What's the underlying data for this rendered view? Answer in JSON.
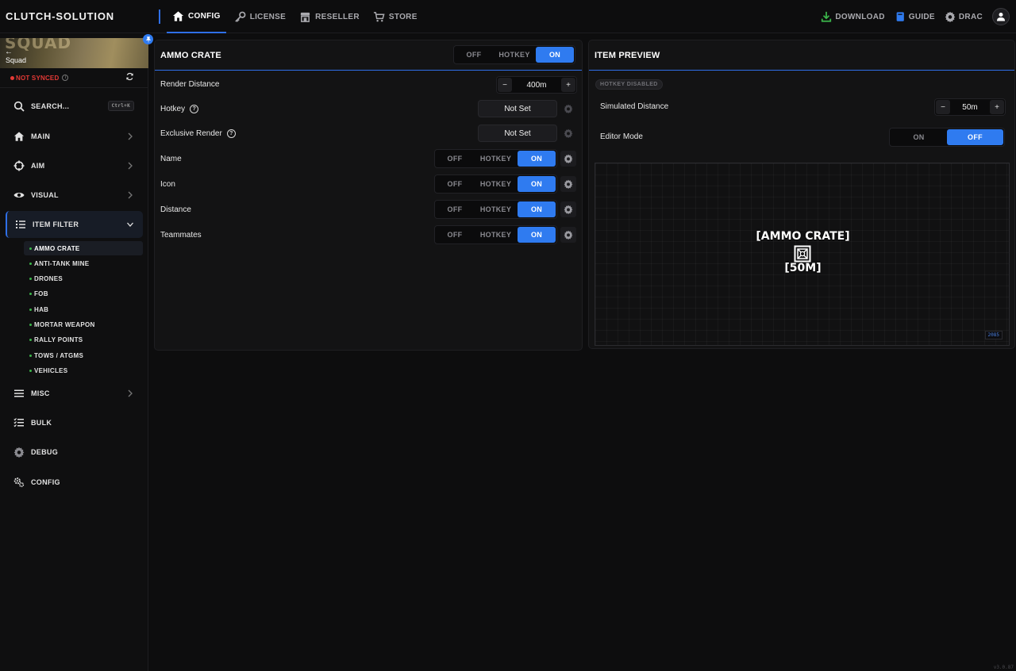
{
  "app": {
    "brand": "CLUTCH-SOLUTION",
    "version": "v3.0.87"
  },
  "topnav": {
    "items": [
      {
        "label": "CONFIG",
        "icon": "home-icon",
        "active": true
      },
      {
        "label": "LICENSE",
        "icon": "key-icon",
        "active": false
      },
      {
        "label": "RESELLER",
        "icon": "store-icon",
        "active": false
      },
      {
        "label": "STORE",
        "icon": "cart-icon",
        "active": false
      }
    ],
    "right": {
      "download": "DOWNLOAD",
      "guide": "GUIDE",
      "user": "DRAC"
    }
  },
  "sidebar": {
    "game": {
      "logo": "SQUAD",
      "back": "←",
      "name": "Squad"
    },
    "sync": {
      "status": "NOT SYNCED",
      "info": "i"
    },
    "search": {
      "label": "SEARCH...",
      "shortcut": "Ctrl+K"
    },
    "items": [
      {
        "label": "MAIN"
      },
      {
        "label": "AIM"
      },
      {
        "label": "VISUAL"
      },
      {
        "label": "ITEM FILTER"
      },
      {
        "label": "MISC"
      },
      {
        "label": "BULK"
      },
      {
        "label": "DEBUG"
      },
      {
        "label": "CONFIG"
      }
    ],
    "item_filter_children": [
      "AMMO CRATE",
      "ANTI-TANK MINE",
      "DRONES",
      "FOB",
      "HAB",
      "MORTAR WEAPON",
      "RALLY POINTS",
      "TOWS / ATGMS",
      "VEHICLES"
    ],
    "active_child": "AMMO CRATE"
  },
  "settings_panel": {
    "title": "AMMO CRATE",
    "mode": {
      "off": "OFF",
      "hotkey": "HOTKEY",
      "on": "ON",
      "selected": "ON"
    },
    "render_distance": {
      "label": "Render Distance",
      "value": "400m",
      "minus": "−",
      "plus": "+"
    },
    "hotkey": {
      "label": "Hotkey",
      "value": "Not Set",
      "help": "?"
    },
    "exclusive_render": {
      "label": "Exclusive Render",
      "value": "Not Set",
      "help": "?"
    },
    "toggles": [
      {
        "label": "Name",
        "off": "OFF",
        "hotkey": "HOTKEY",
        "on": "ON",
        "selected": "ON"
      },
      {
        "label": "Icon",
        "off": "OFF",
        "hotkey": "HOTKEY",
        "on": "ON",
        "selected": "ON"
      },
      {
        "label": "Distance",
        "off": "OFF",
        "hotkey": "HOTKEY",
        "on": "ON",
        "selected": "ON"
      },
      {
        "label": "Teammates",
        "off": "OFF",
        "hotkey": "HOTKEY",
        "on": "ON",
        "selected": "ON"
      }
    ]
  },
  "preview_panel": {
    "title": "ITEM PREVIEW",
    "hotkey_badge": "HOTKEY DISABLED",
    "simulated_distance": {
      "label": "Simulated Distance",
      "value": "50m",
      "minus": "−",
      "plus": "+"
    },
    "editor_mode": {
      "label": "Editor Mode",
      "on": "ON",
      "off": "OFF",
      "selected": "OFF"
    },
    "esp": {
      "name": "[AMMO CRATE]",
      "distance": "[50M]",
      "icon": "ammo-crate-icon"
    },
    "zoom": "2085"
  },
  "colors": {
    "accent": "#2f7bf0",
    "danger": "#e53935",
    "bullet": "#3bb54a",
    "download": "#3bb54a"
  }
}
